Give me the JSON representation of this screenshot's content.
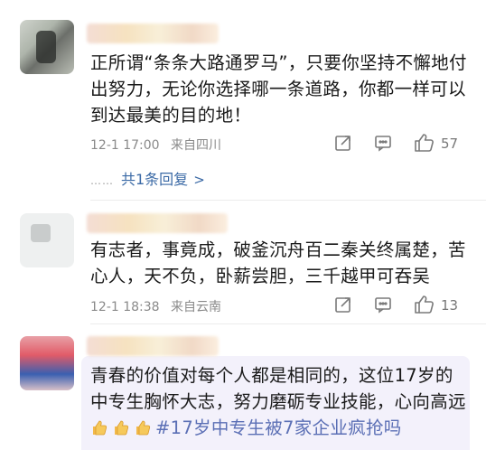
{
  "comments": [
    {
      "text": "正所谓“条条大路通罗马”，只要你坚持不懈地付出努力，无论你选择哪一条道路，你都一样可以到达最美的目的地！",
      "time": "12-1 17:00",
      "location": "来自四川",
      "likes": "57",
      "replies_label": "共1条回复",
      "replies_dots": "……"
    },
    {
      "text": "有志者，事竟成，破釜沉舟百二秦关终属楚，苦心人，天不负，卧薪尝胆，三千越甲可吞吴",
      "time": "12-1 18:38",
      "location": "来自云南",
      "likes": "13"
    },
    {
      "text_main": "青春的价值对每个人都是相同的，这位17岁的中专生胸怀大志，努力磨砺专业技能，心向高远",
      "hashtag": "#17岁中专生被7家企业疯抢吗"
    }
  ],
  "icons": {
    "share": "share-icon",
    "comment": "comment-icon",
    "like": "thumbs-up-icon",
    "emoji": "thumbs-up-emoji-icon",
    "chevron": "chevron-right-icon"
  },
  "colors": {
    "link": "#3b6aa6",
    "hashtag": "#5b6fb5",
    "meta": "#8a8a8a"
  }
}
